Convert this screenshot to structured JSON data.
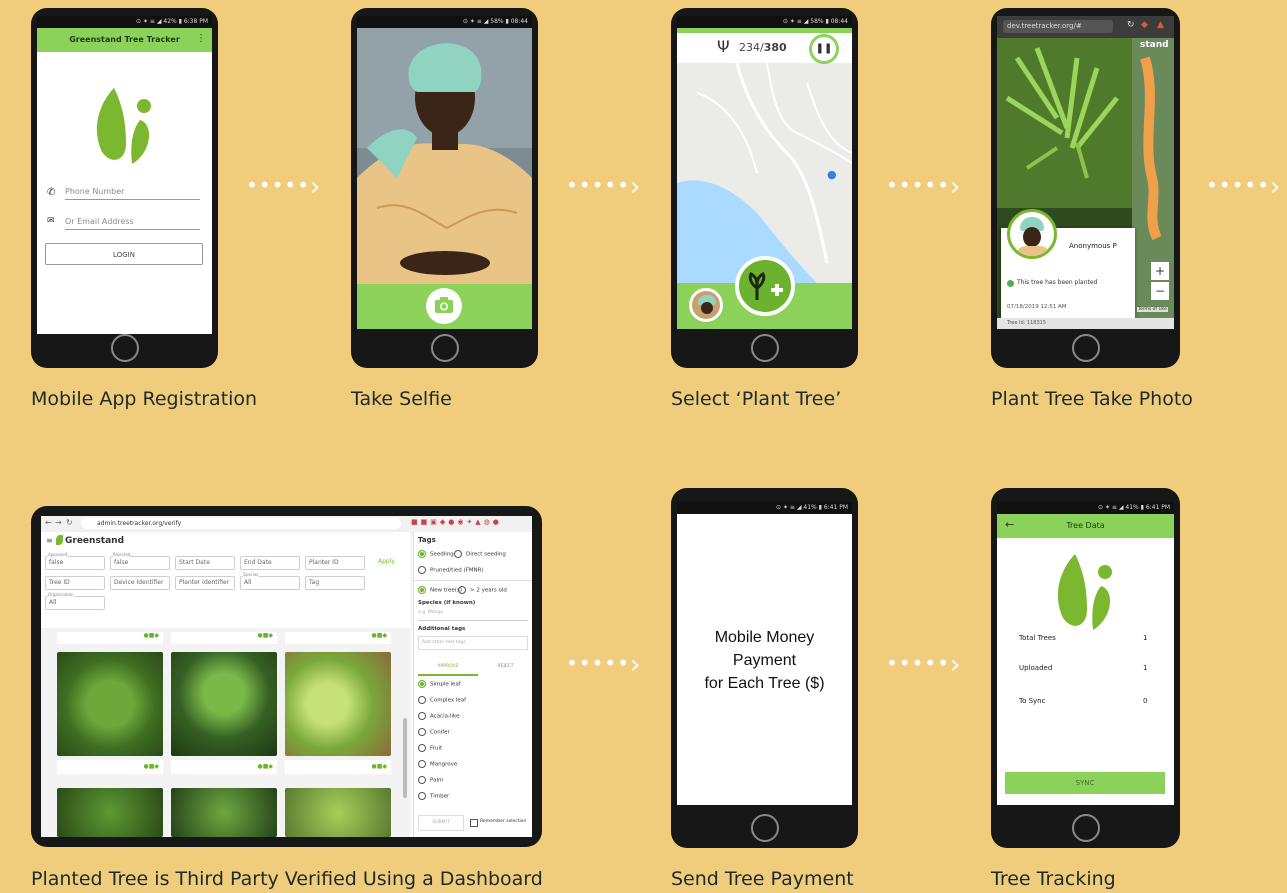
{
  "captions": {
    "step1": "Mobile App Registration",
    "step2": "Take Selfie",
    "step3": "Select ‘Plant Tree’",
    "step4": "Plant Tree Take Photo",
    "step5": "Planted Tree is Third Party Verified Using a Dashboard",
    "step6": "Send Tree Payment",
    "step7": "Tree Tracking"
  },
  "registration": {
    "status": "⊙ ✶ ≡ ◢ 42% ▮ 6:38 PM",
    "app_title": "Greenstand Tree Tracker",
    "menu_icon": "more-vert",
    "phone_placeholder": "Phone Number",
    "email_placeholder": "Or Email Address",
    "login_label": "LOGIN"
  },
  "selfie": {
    "status": "⊙ ✶ ≡ ◢ 58% ▮ 08:44",
    "camera_icon": "camera"
  },
  "plant_tree": {
    "status": "⊙ ✶ ≡ ◢ 58% ▮ 08:44",
    "count": "234",
    "separator": "/",
    "total": "380",
    "pause_icon": "pause",
    "plant_icon": "plant-plus"
  },
  "tree_photo": {
    "url": "dev.treetracker.org/#",
    "top_right_text": "stand",
    "planter_name": "Anonymous P",
    "status_text": "This tree has been planted",
    "date": "07/18/2019 12:51 AM",
    "tree_id": "Tree Id: 118315",
    "terms": "Terms of Use",
    "zoom_in": "+",
    "zoom_out": "−"
  },
  "dashboard": {
    "url": "admin.treetracker.org/verify",
    "brand": "Greenstand",
    "filters": {
      "approved_label": "Approved",
      "approved_value": "false",
      "rejected_label": "Rejected",
      "rejected_value": "false",
      "start_date": "Start Date",
      "end_date": "End Date",
      "planter_id": "Planter ID",
      "apply": "Apply",
      "tree_id": "Tree ID",
      "device_identifier": "Device Identifier",
      "planter_identifier": "Planter Identifier",
      "species_label": "Species",
      "species_value": "All",
      "tag": "Tag",
      "organization_label": "Organization",
      "organization_value": "All"
    },
    "tags_panel": {
      "title": "Tags",
      "seedling": "Seedling",
      "direct_seeding": "Direct seeding",
      "pruned": "Pruned/tied (FMNR)",
      "new_trees": "New tree(s)",
      "older": "> 2 years old",
      "species_title": "Species (if known)",
      "species_placeholder": "e.g. Mango",
      "additional_title": "Additional tags",
      "additional_placeholder": "Add other text tags",
      "approve": "APPROVE",
      "reject": "REJECT",
      "leaf_types": [
        "Simple leaf",
        "Complex leaf",
        "Acacia-like",
        "Conifer",
        "Fruit",
        "Mangrove",
        "Palm",
        "Timber"
      ],
      "submit": "SUBMIT",
      "remember": "Remember selection"
    }
  },
  "payment": {
    "status": "⊙ ✶ ≡ ◢ 41% ▮ 6:41 PM",
    "line1": "Mobile Money",
    "line2": "Payment",
    "line3": "for Each Tree ($)"
  },
  "tree_data": {
    "status": "⊙ ✶ ≡ ◢ 41% ▮ 6:41 PM",
    "title": "Tree Data",
    "back_icon": "arrow-left",
    "rows": [
      {
        "label": "Total Trees",
        "value": "1"
      },
      {
        "label": "Uploaded",
        "value": "1"
      },
      {
        "label": "To Sync",
        "value": "0"
      }
    ],
    "sync_label": "SYNC"
  },
  "colors": {
    "background": "#f0cd7c",
    "green": "#8cd25a",
    "logo_green": "#7cb82f",
    "phone": "#171717"
  }
}
